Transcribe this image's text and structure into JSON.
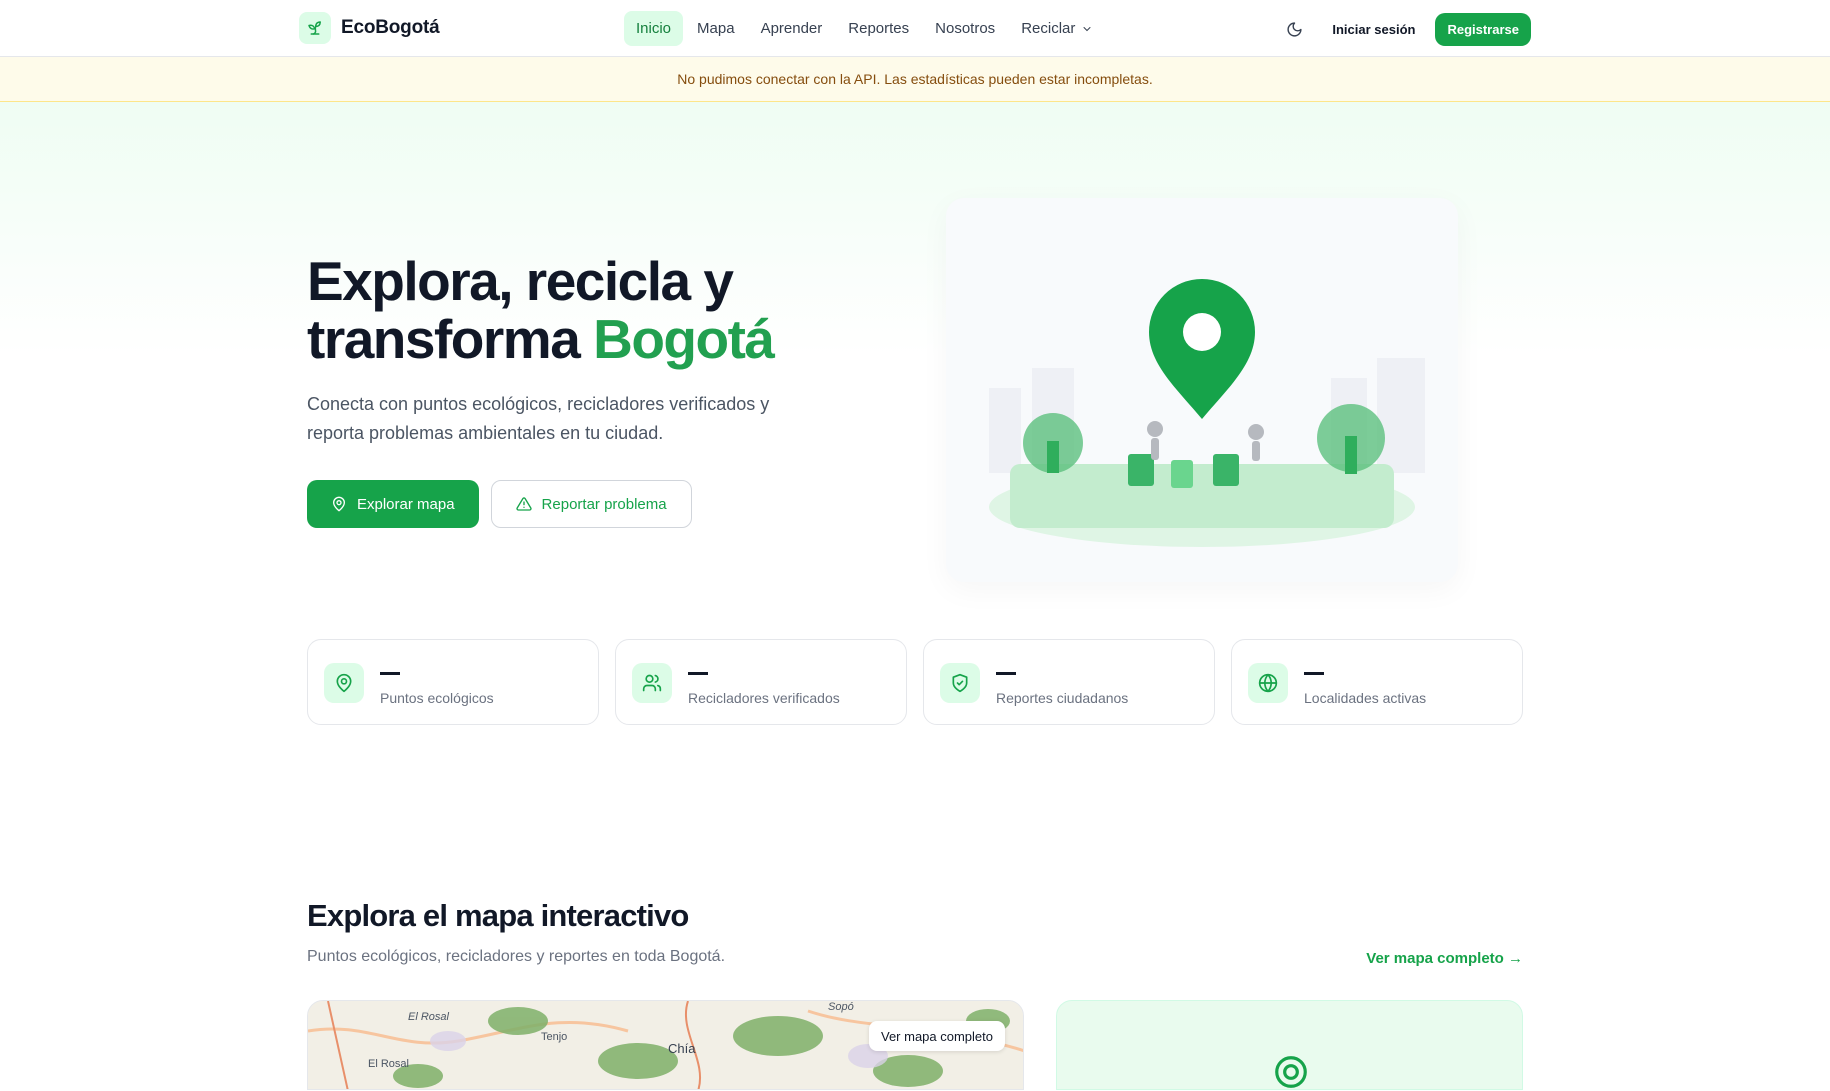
{
  "brand": {
    "name": "EcoBogotá"
  },
  "nav": {
    "items": [
      {
        "label": "Inicio",
        "active": true
      },
      {
        "label": "Mapa"
      },
      {
        "label": "Aprender"
      },
      {
        "label": "Reportes"
      },
      {
        "label": "Nosotros"
      },
      {
        "label": "Reciclar"
      }
    ]
  },
  "header": {
    "login_label": "Iniciar sesión",
    "register_label": "Registrarse"
  },
  "alert": {
    "text": "No pudimos conectar con la API. Las estadísticas pueden estar incompletas."
  },
  "hero": {
    "title_line1": "Explora, recicla y",
    "title_line2": "transforma",
    "title_accent": "Bogotá",
    "subtitle": "Conecta con puntos ecológicos, recicladores verificados y reporta problemas ambientales en tu ciudad.",
    "primary_button": "Explorar mapa",
    "secondary_button": "Reportar problema"
  },
  "stats": [
    {
      "value": "—",
      "label": "Puntos ecológicos",
      "icon": "map-pin-icon"
    },
    {
      "value": "—",
      "label": "Recicladores verificados",
      "icon": "users-icon"
    },
    {
      "value": "—",
      "label": "Reportes ciudadanos",
      "icon": "shield-icon"
    },
    {
      "value": "—",
      "label": "Localidades activas",
      "icon": "globe-icon"
    }
  ],
  "map_section": {
    "title": "Explora el mapa interactivo",
    "subtitle": "Puntos ecológicos, recicladores y reportes en toda Bogotá.",
    "link": "Ver mapa completo →",
    "map_button": "Ver mapa completo",
    "place_labels": [
      "El Rosal",
      "Tenjo",
      "Chía",
      "Sopó",
      "El Rosal"
    ]
  },
  "colors": {
    "primary": "#16a34a",
    "accent": "#22a050",
    "alert_bg": "#fefbea",
    "alert_text": "#854d0e"
  }
}
